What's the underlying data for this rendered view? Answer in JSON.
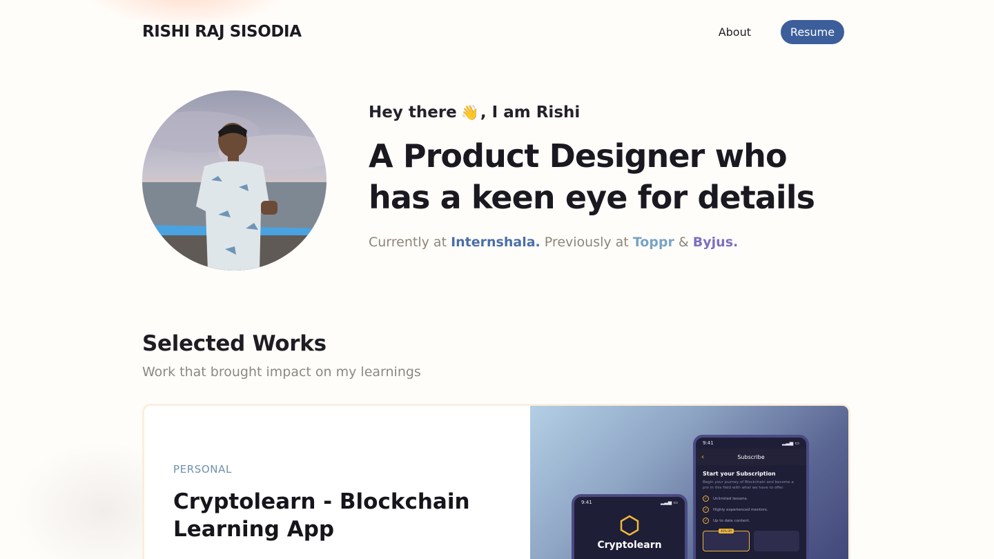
{
  "nav": {
    "brand": "RISHI RAJ SISODIA",
    "about_label": "About",
    "resume_label": "Resume"
  },
  "hero": {
    "greeting_prefix": "Hey there",
    "greeting_emoji": "👋",
    "greeting_suffix": ", I am Rishi",
    "headline": "A Product Designer who has a keen eye for details",
    "current_prefix": "Currently at",
    "current_company": "Internshala.",
    "previous_prefix": "Previously at",
    "previous_company_1": "Toppr",
    "ampersand": "&",
    "previous_company_2": "Byjus."
  },
  "works": {
    "title": "Selected Works",
    "subtitle": "Work that brought impact on my learnings"
  },
  "card": {
    "tag": "PERSONAL",
    "title": "Cryptolearn - Blockchain Learning App",
    "mockup": {
      "front_time": "9:41",
      "front_header": "Subscribe",
      "front_heading": "Start your Subscription",
      "front_sub": "Begin your journey of Blockchain and become a pro in this field with what we have to offer.",
      "features": [
        "Unlimited lessons.",
        "Highly experienced mentors.",
        "Up to date content."
      ],
      "plan_badge": "40% Off",
      "back_time": "9:41",
      "back_app_name": "Cryptolearn"
    }
  },
  "colors": {
    "resume_button": "#3c5e9b",
    "internshala": "#4a6fa8",
    "toppr": "#78a3c6",
    "byjus": "#7d6fc0",
    "accent_gold": "#f1b83a"
  },
  "icons": [
    "waving-hand-icon",
    "back-arrow-icon",
    "check-icon",
    "hexagon-logo-icon"
  ]
}
